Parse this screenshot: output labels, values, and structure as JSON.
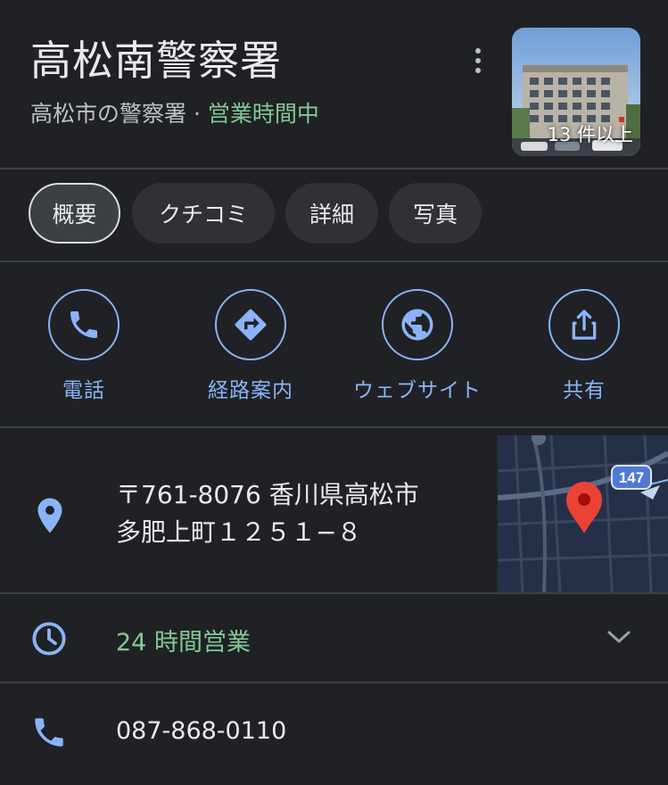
{
  "place": {
    "name": "高松南警察署",
    "category": "高松市の警察署",
    "separator": " · ",
    "status": "営業時間中",
    "photo_count": "13 件以上"
  },
  "tabs": [
    {
      "label": "概要",
      "active": true
    },
    {
      "label": "クチコミ",
      "active": false
    },
    {
      "label": "詳細",
      "active": false
    },
    {
      "label": "写真",
      "active": false
    }
  ],
  "actions": [
    {
      "label": "電話",
      "icon": "phone-icon"
    },
    {
      "label": "経路案内",
      "icon": "directions-icon"
    },
    {
      "label": "ウェブサイト",
      "icon": "globe-icon"
    },
    {
      "label": "共有",
      "icon": "share-icon"
    }
  ],
  "address": {
    "line1": "〒761-8076 香川県高松市",
    "line2": "多肥上町１２５１−８",
    "map_road_badge": "147"
  },
  "hours": {
    "text": "24 時間営業"
  },
  "phone": {
    "number": "087-868-0110"
  },
  "colors": {
    "background": "#202124",
    "accent": "#8ab4f8",
    "open_green": "#81c995",
    "pin_red": "#ea4335"
  }
}
